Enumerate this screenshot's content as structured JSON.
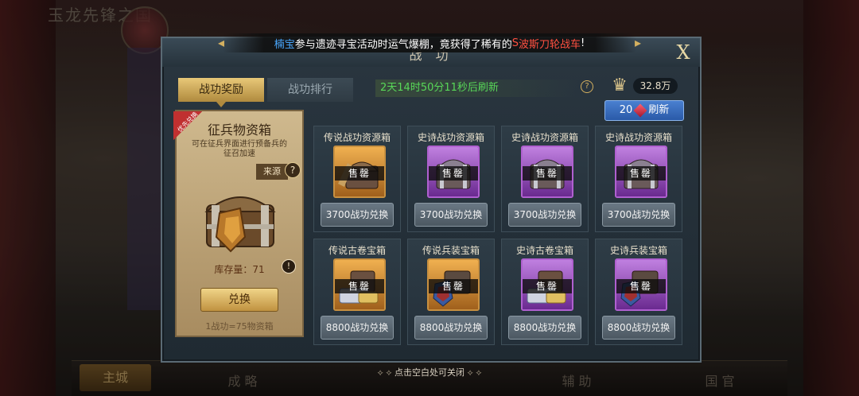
{
  "background": {
    "title": "玉龙先锋之国",
    "bottom_tabs": [
      "主城",
      "成 略",
      "",
      "辅 助",
      "国 官"
    ]
  },
  "marquee": {
    "player": "楠宝",
    "text_before": "参与遗迹寻宝活动时运气爆棚，竟获得了稀有的",
    "grade": "S",
    "item": " 波斯刀轮战车",
    "text_after": "!"
  },
  "dialog": {
    "title": "战 功",
    "close_label": "X",
    "tabs": [
      {
        "label": "战功奖励",
        "active": true
      },
      {
        "label": "战功排行",
        "active": false
      }
    ],
    "timer_text": "2天14时50分11秒后刷新",
    "merit_total": "32.8万",
    "refresh": {
      "cost": "20",
      "label": "刷新"
    }
  },
  "featured": {
    "ribbon": "优先兑换",
    "name": "征兵物资箱",
    "desc": "可在征兵界面进行预备兵的征召加速",
    "source_label": "来源",
    "stock_text": "库存量：71",
    "exchange_label": "兑换",
    "rate_text": "1战功=75物资箱"
  },
  "items": [
    {
      "name": "传说战功资源箱",
      "tier": "legend",
      "status": "售罄",
      "price": "3700战功兑换",
      "art": "chest-axe"
    },
    {
      "name": "史诗战功资源箱",
      "tier": "epic",
      "status": "售罄",
      "price": "3700战功兑换",
      "art": "chest"
    },
    {
      "name": "史诗战功资源箱",
      "tier": "epic",
      "status": "售罄",
      "price": "3700战功兑换",
      "art": "chest"
    },
    {
      "name": "史诗战功资源箱",
      "tier": "epic",
      "status": "售罄",
      "price": "3700战功兑换",
      "art": "chest"
    },
    {
      "name": "传说古卷宝箱",
      "tier": "legend",
      "status": "售罄",
      "price": "8800战功兑换",
      "art": "scroll"
    },
    {
      "name": "传说兵装宝箱",
      "tier": "legend",
      "status": "售罄",
      "price": "8800战功兑换",
      "art": "shield"
    },
    {
      "name": "史诗古卷宝箱",
      "tier": "epic",
      "status": "售罄",
      "price": "8800战功兑换",
      "art": "scroll"
    },
    {
      "name": "史诗兵装宝箱",
      "tier": "epic",
      "status": "售罄",
      "price": "8800战功兑换",
      "art": "shield"
    }
  ],
  "hint": "点击空白处可关闭"
}
